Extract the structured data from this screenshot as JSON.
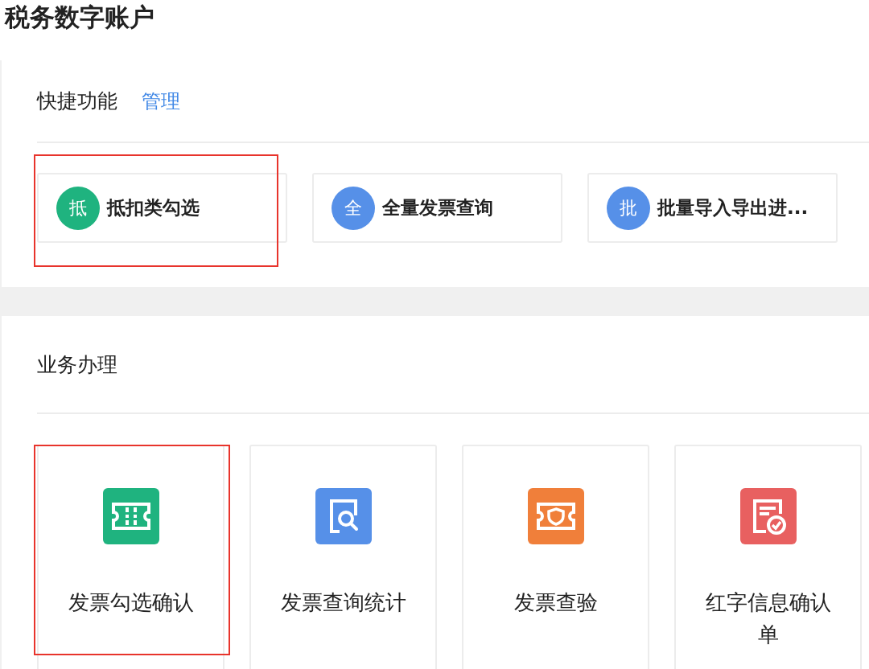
{
  "page": {
    "title": "税务数字账户"
  },
  "shortcuts": {
    "title": "快捷功能",
    "manage_link": "管理",
    "items": [
      {
        "badge": "抵",
        "label": "抵扣类勾选",
        "color": "#1fb37f",
        "highlighted": true
      },
      {
        "badge": "全",
        "label": "全量发票查询",
        "color": "#5690e8",
        "highlighted": false
      },
      {
        "badge": "批",
        "label": "批量导入导出进...",
        "color": "#5690e8",
        "highlighted": false
      }
    ]
  },
  "business": {
    "title": "业务办理",
    "items": [
      {
        "kind": "ticket",
        "label": "发票勾选确认",
        "color": "#1fb37f",
        "highlighted": true
      },
      {
        "kind": "search-doc",
        "label": "发票查询统计",
        "color": "#5690e8",
        "highlighted": false
      },
      {
        "kind": "shield-ticket",
        "label": "发票查验",
        "color": "#f07f3a",
        "highlighted": false
      },
      {
        "kind": "check-doc",
        "label": "红字信息确认单",
        "color": "#e86060",
        "highlighted": false
      }
    ]
  }
}
